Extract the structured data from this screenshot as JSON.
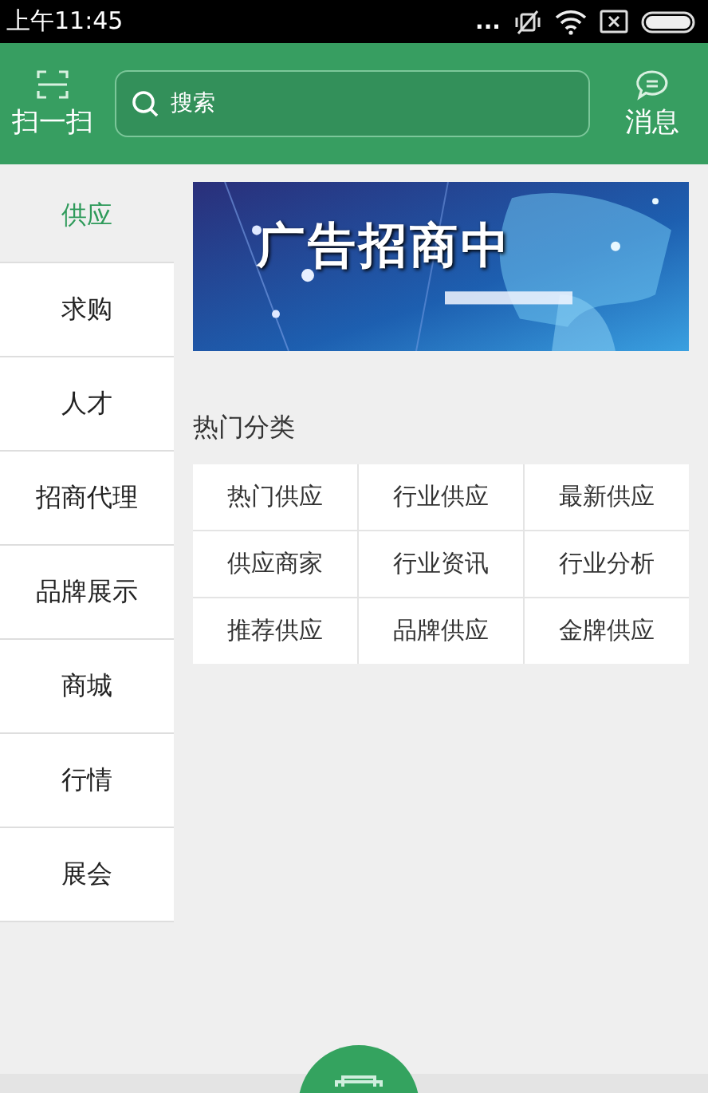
{
  "status_bar": {
    "time": "上午11:45",
    "dots": "..."
  },
  "header": {
    "scan_label": "扫一扫",
    "search": {
      "placeholder": "搜索"
    },
    "message_label": "消息"
  },
  "sidebar": {
    "items": [
      {
        "label": "供应",
        "selected": true
      },
      {
        "label": "求购",
        "selected": false
      },
      {
        "label": "人才",
        "selected": false
      },
      {
        "label": "招商代理",
        "selected": false
      },
      {
        "label": "品牌展示",
        "selected": false
      },
      {
        "label": "商城",
        "selected": false
      },
      {
        "label": "行情",
        "selected": false
      },
      {
        "label": "展会",
        "selected": false
      }
    ]
  },
  "banner": {
    "title": "广告招商中"
  },
  "hot_categories": {
    "title": "热门分类",
    "items": [
      "热门供应",
      "行业供应",
      "最新供应",
      "供应商家",
      "行业资讯",
      "行业分析",
      "推荐供应",
      "品牌供应",
      "金牌供应"
    ]
  }
}
